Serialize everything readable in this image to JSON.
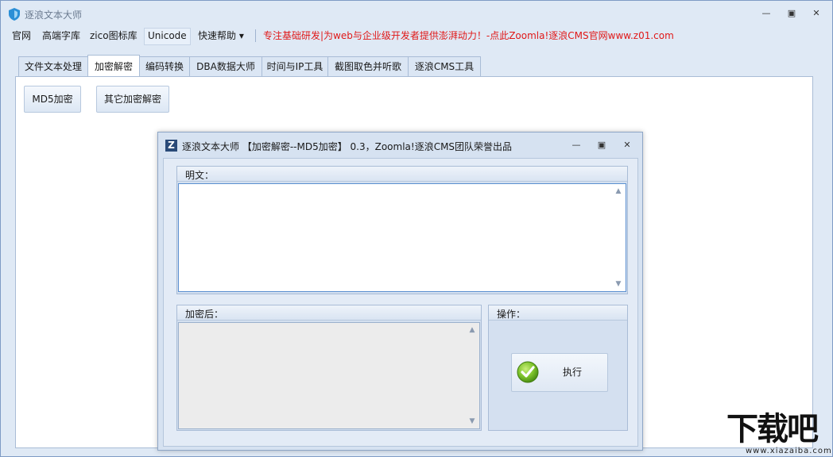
{
  "window": {
    "title": "逐浪文本大师",
    "controls": {
      "minimize": "—",
      "restore": "▣",
      "close": "✕"
    }
  },
  "menu": {
    "items": [
      "官网",
      "高端字库",
      "zico图标库",
      "Unicode",
      "快速帮助 ▾"
    ],
    "banner": "专注基础研发|为web与企业级开发者提供澎湃动力！-点此Zoomla!逐浪CMS官网www.z01.com",
    "banner_color": "#e01818"
  },
  "tabs": [
    "文件文本处理",
    "加密解密",
    "编码转换",
    "DBA数据大师",
    "时间与IP工具",
    "截图取色并听歌",
    "逐浪CMS工具"
  ],
  "active_tab": "加密解密",
  "panel": {
    "buttons": [
      "MD5加密",
      "其它加密解密"
    ]
  },
  "dialog": {
    "icon_letter": "Z",
    "title": "逐浪文本大师 【加密解密--MD5加密】 0.3，Zoomla!逐浪CMS团队荣誉出品",
    "controls": {
      "minimize": "—",
      "restore": "▣",
      "close": "✕"
    },
    "plaintext": {
      "label": "明文：",
      "value": ""
    },
    "encrypted": {
      "label": "加密后：",
      "value": ""
    },
    "operation": {
      "label": "操作：",
      "execute_label": "执行"
    }
  },
  "watermark": {
    "main": "下载吧",
    "sub": "www.xiazaiba.com"
  }
}
